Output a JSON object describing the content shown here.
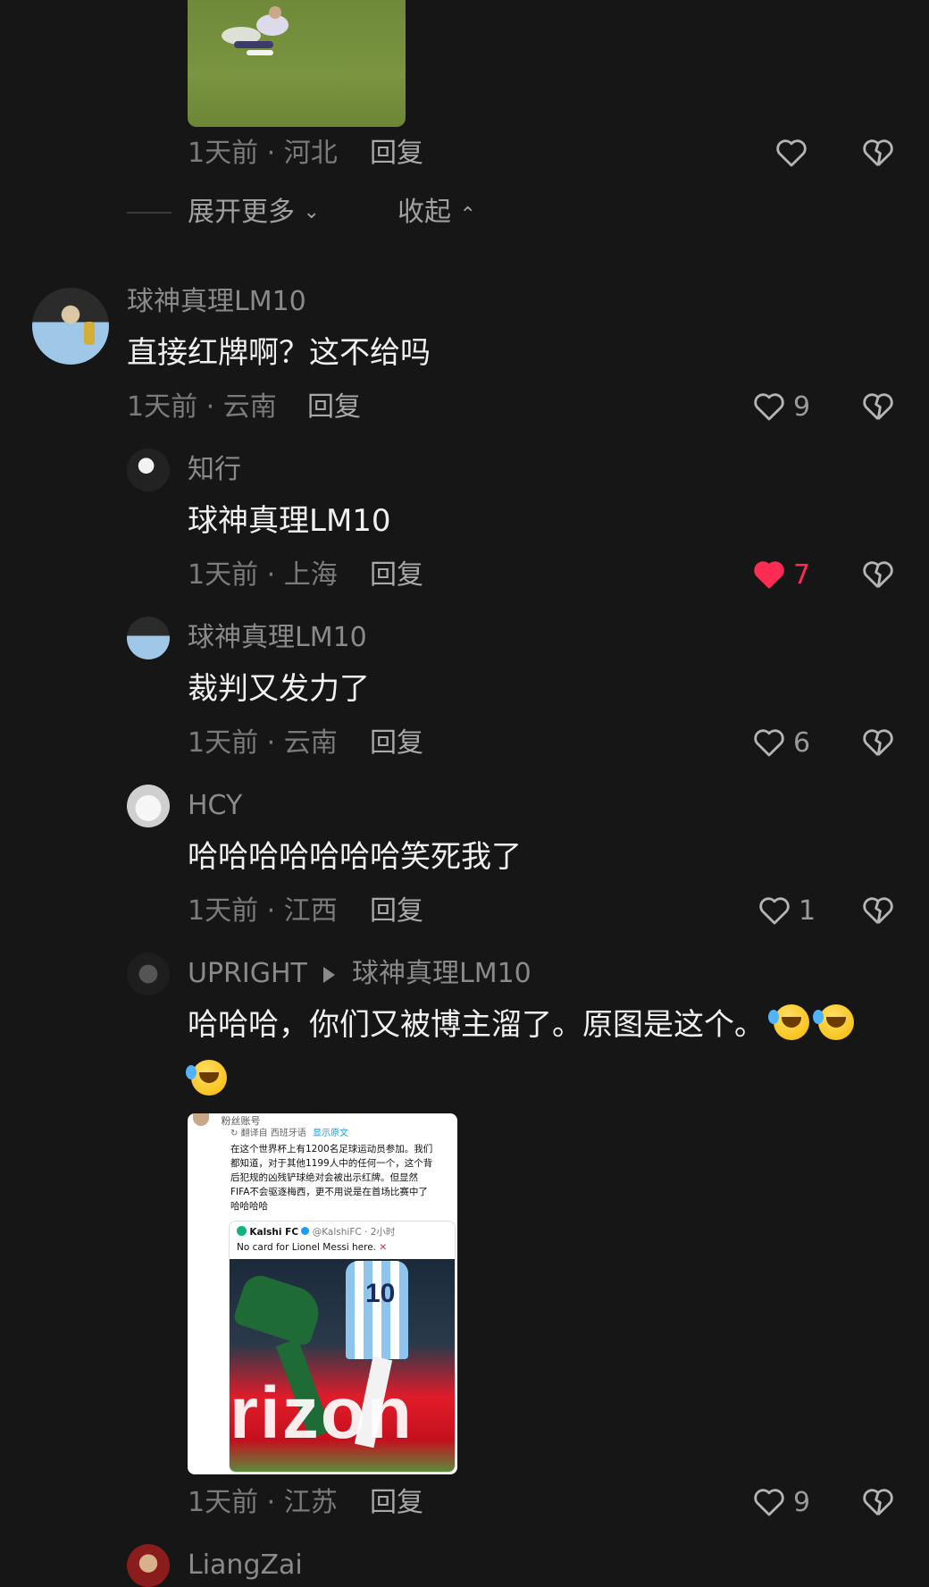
{
  "top_comment": {
    "meta": "1天前 · 河北",
    "reply": "回复",
    "expand_more": "展开更多",
    "collapse": "收起"
  },
  "comments": [
    {
      "username": "球神真理LM10",
      "text": "直接红牌啊？这不给吗",
      "meta": "1天前 · 云南",
      "reply": "回复",
      "likes": "9",
      "liked": false
    },
    {
      "username": "知行",
      "text": "球神真理LM10",
      "meta": "1天前 · 上海",
      "reply": "回复",
      "likes": "7",
      "liked": true
    },
    {
      "username": "球神真理LM10",
      "text": "裁判又发力了",
      "meta": "1天前 · 云南",
      "reply": "回复",
      "likes": "6",
      "liked": false
    },
    {
      "username": "HCY",
      "text": "哈哈哈哈哈哈哈笑死我了",
      "meta": "1天前 · 江西",
      "reply": "回复",
      "likes": "1",
      "liked": false
    },
    {
      "username": "UPRIGHT",
      "reply_to": "球神真理LM10",
      "text": "哈哈哈，你们又被博主溜了。原图是这个。",
      "meta": "1天前 · 江苏",
      "reply": "回复",
      "likes": "9",
      "liked": false
    }
  ],
  "embedded_post": {
    "account": "粉丝账号",
    "translated_from": "翻译自 西班牙语",
    "show_original": "显示原文",
    "body": [
      "在这个世界杯上有1200名足球运动员参加。我们",
      "都知道，对于其他1199人中的任何一个，这个背",
      "后犯规的凶残铲球绝对会被出示红牌。但显然",
      "FIFA不会驱逐梅西，更不用说是在首场比赛中了",
      "哈哈哈哈"
    ],
    "quoted_name": "Kalshi FC",
    "quoted_handle": "@KalshiFC · 2小时",
    "quoted_text": "No card for Lionel Messi here.",
    "banner_text": "rizon",
    "jersey_number": "10"
  },
  "bottom_username_partial": "LiangZai",
  "colors": {
    "background": "#161616",
    "liked_heart": "#fe2c55",
    "meta_text": "#7b7b7b"
  }
}
